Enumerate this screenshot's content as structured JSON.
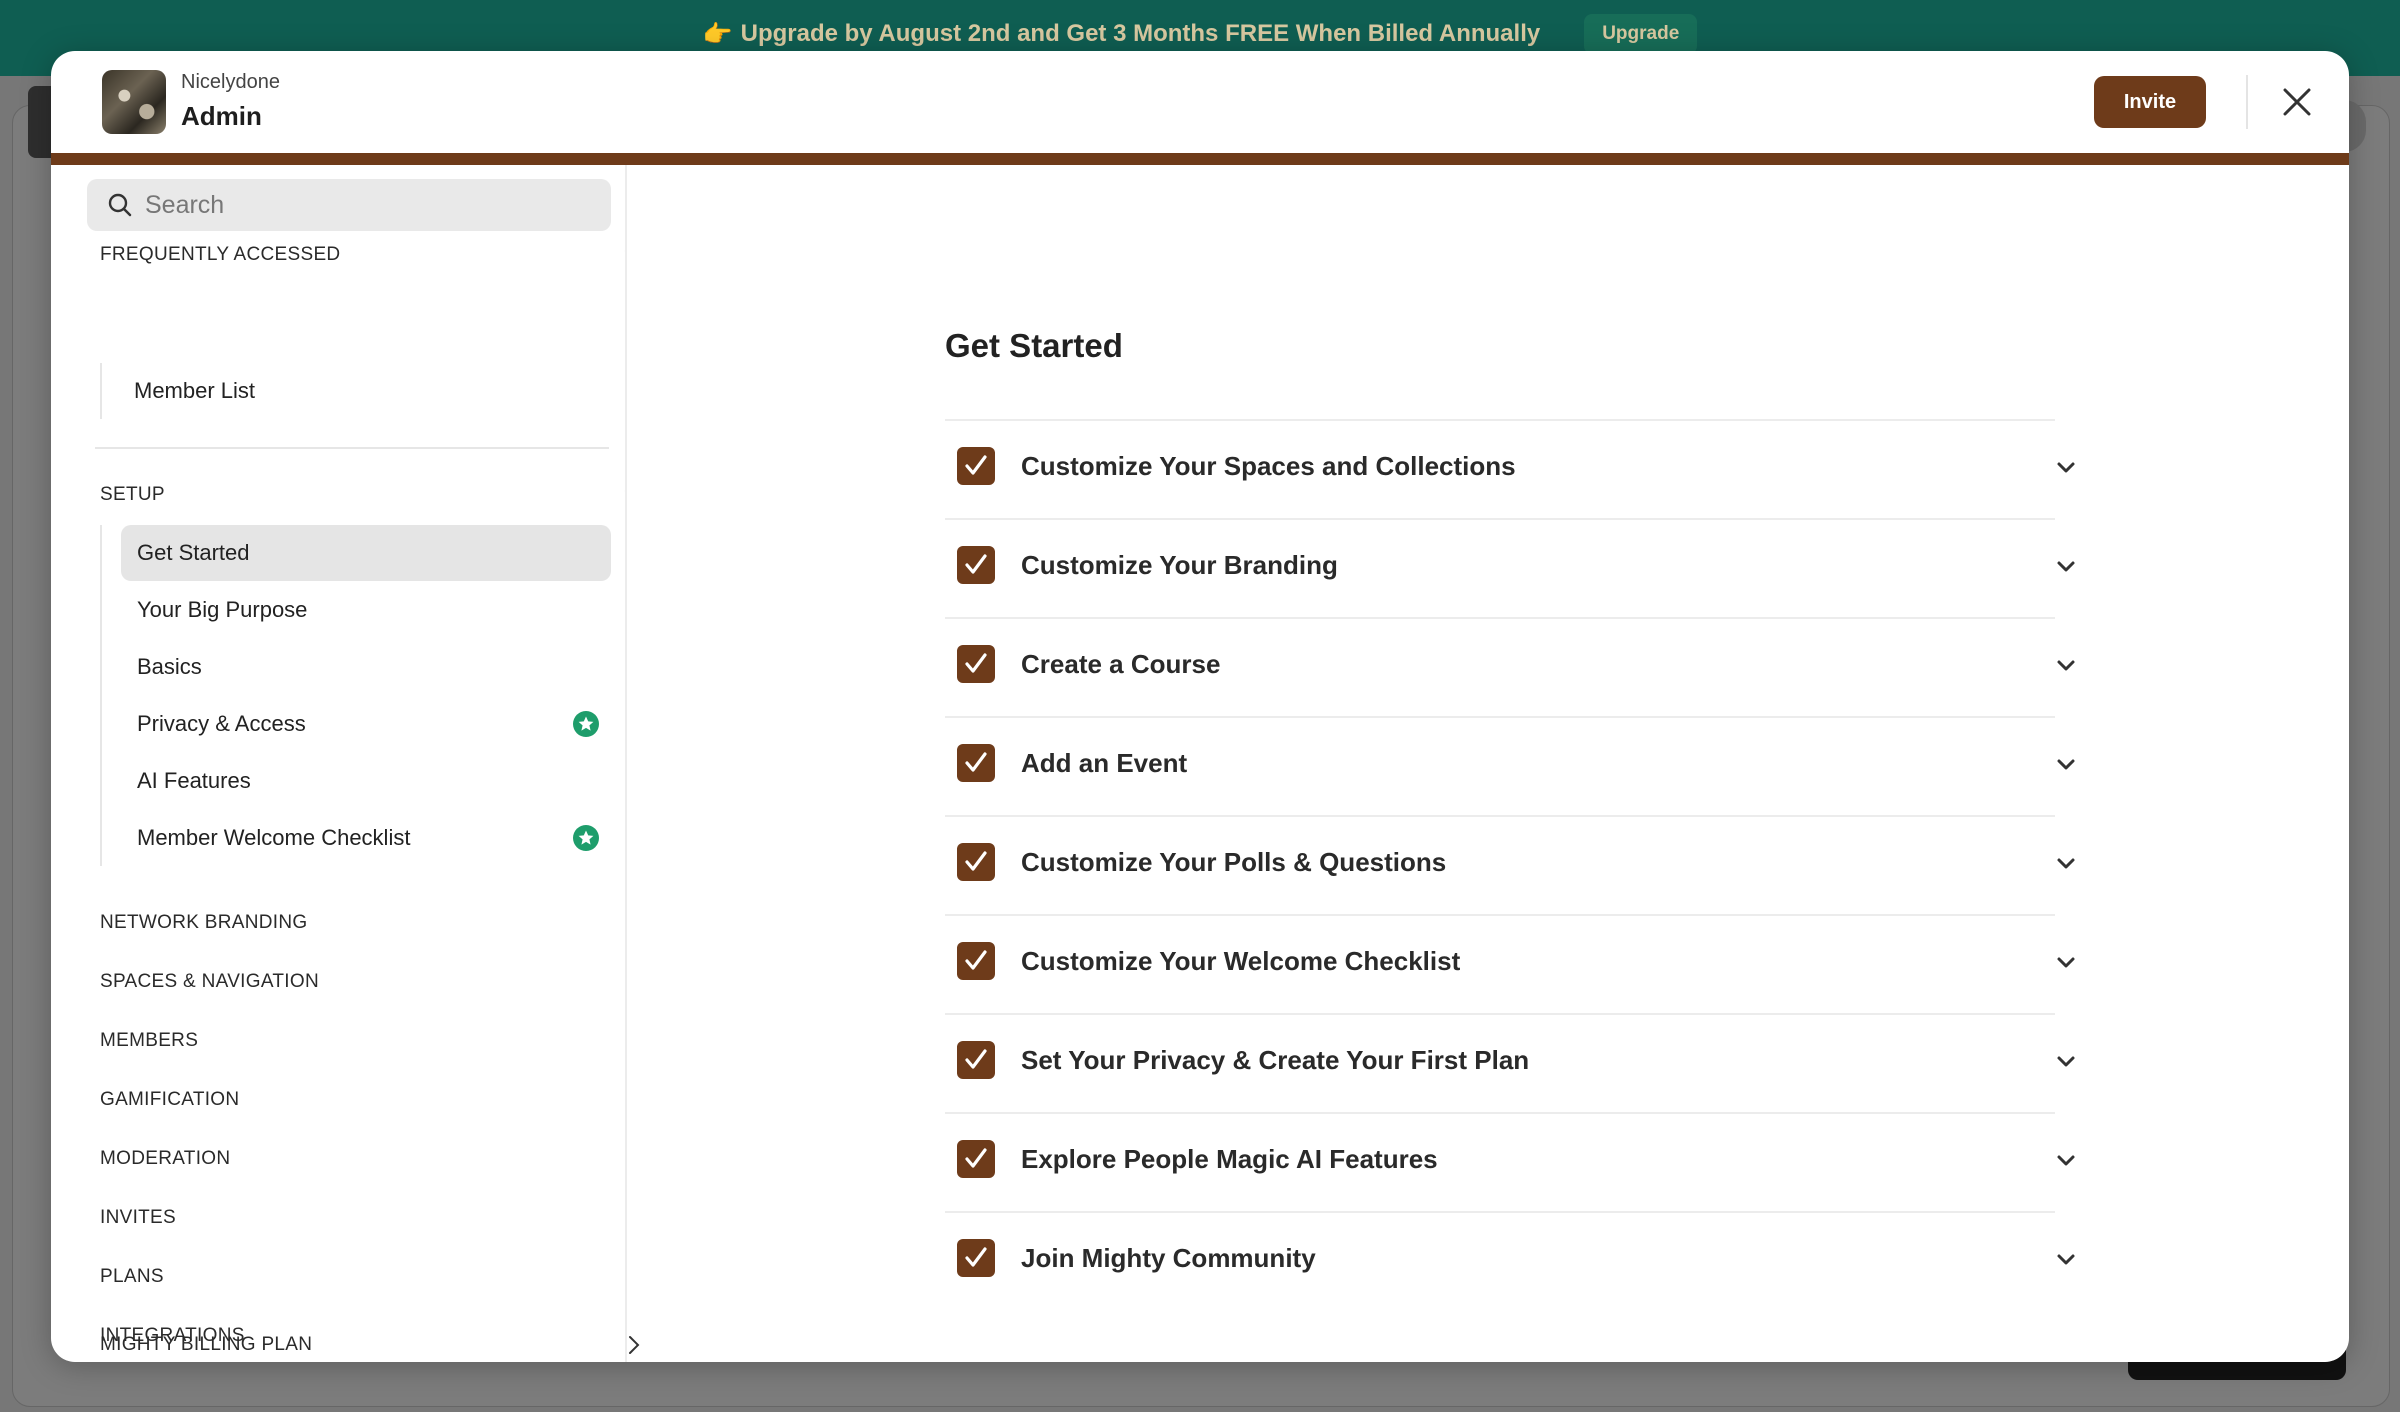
{
  "banner": {
    "emoji": "👉",
    "text": "Upgrade by August 2nd and Get 3 Months FREE When Billed Annually",
    "button": "Upgrade"
  },
  "header": {
    "org_name": "Nicelydone",
    "title": "Admin",
    "invite_label": "Invite"
  },
  "search": {
    "placeholder": "Search"
  },
  "sidebar": {
    "frequently_accessed": {
      "label": "FREQUENTLY ACCESSED",
      "items": [
        {
          "label": "Member List"
        }
      ]
    },
    "setup": {
      "label": "SETUP",
      "items": [
        {
          "label": "Get Started",
          "active": true,
          "badge": false
        },
        {
          "label": "Your Big Purpose",
          "badge": false
        },
        {
          "label": "Basics",
          "badge": false
        },
        {
          "label": "Privacy & Access",
          "badge": true
        },
        {
          "label": "AI Features",
          "badge": false
        },
        {
          "label": "Member Welcome Checklist",
          "badge": true
        }
      ]
    },
    "sections": [
      {
        "label": "NETWORK BRANDING"
      },
      {
        "label": "SPACES & NAVIGATION"
      },
      {
        "label": "MEMBERS"
      },
      {
        "label": "GAMIFICATION"
      },
      {
        "label": "MODERATION"
      },
      {
        "label": "INVITES"
      },
      {
        "label": "PLANS"
      },
      {
        "label": "INTEGRATIONS"
      },
      {
        "label": "MIGHTY BILLING PLAN"
      }
    ]
  },
  "main": {
    "title": "Get Started",
    "checklist": [
      {
        "label": "Customize Your Spaces and Collections",
        "checked": true
      },
      {
        "label": "Customize Your Branding",
        "checked": true
      },
      {
        "label": "Create a Course",
        "checked": true
      },
      {
        "label": "Add an Event",
        "checked": true
      },
      {
        "label": "Customize Your Polls & Questions",
        "checked": true
      },
      {
        "label": "Customize Your Welcome Checklist",
        "checked": true
      },
      {
        "label": "Set Your Privacy & Create Your First Plan",
        "checked": true
      },
      {
        "label": "Explore People Magic AI Features",
        "checked": true
      },
      {
        "label": "Join Mighty Community",
        "checked": true
      }
    ]
  },
  "colors": {
    "accent": "#6e3b1a",
    "banner": "#0f5e52",
    "badge_green": "#1e9d6b"
  }
}
